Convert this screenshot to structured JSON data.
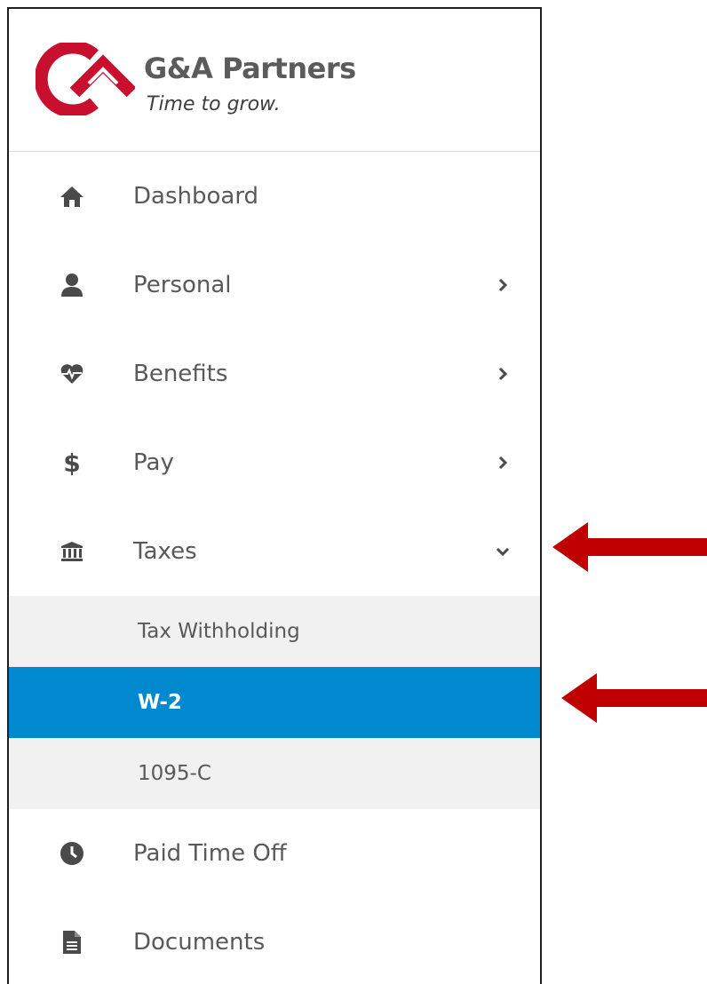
{
  "brand": {
    "name": "G&A Partners",
    "tagline": "Time to grow."
  },
  "menu": {
    "dashboard": "Dashboard",
    "personal": "Personal",
    "benefits": "Benefits",
    "pay": "Pay",
    "taxes": "Taxes",
    "paid_time_off": "Paid Time Off",
    "documents": "Documents"
  },
  "taxes_submenu": {
    "tax_withholding": "Tax Withholding",
    "w2": "W-2",
    "c1095": "1095-C"
  },
  "icons": {
    "dashboard": "home-icon",
    "personal": "user-icon",
    "benefits": "heartbeat-icon",
    "pay": "dollar-icon",
    "taxes": "bank-icon",
    "paid_time_off": "clock-icon",
    "documents": "document-icon"
  },
  "colors": {
    "brand_red": "#c8102e",
    "active_blue": "#0089cf",
    "annotation_arrow": "#c00000"
  }
}
